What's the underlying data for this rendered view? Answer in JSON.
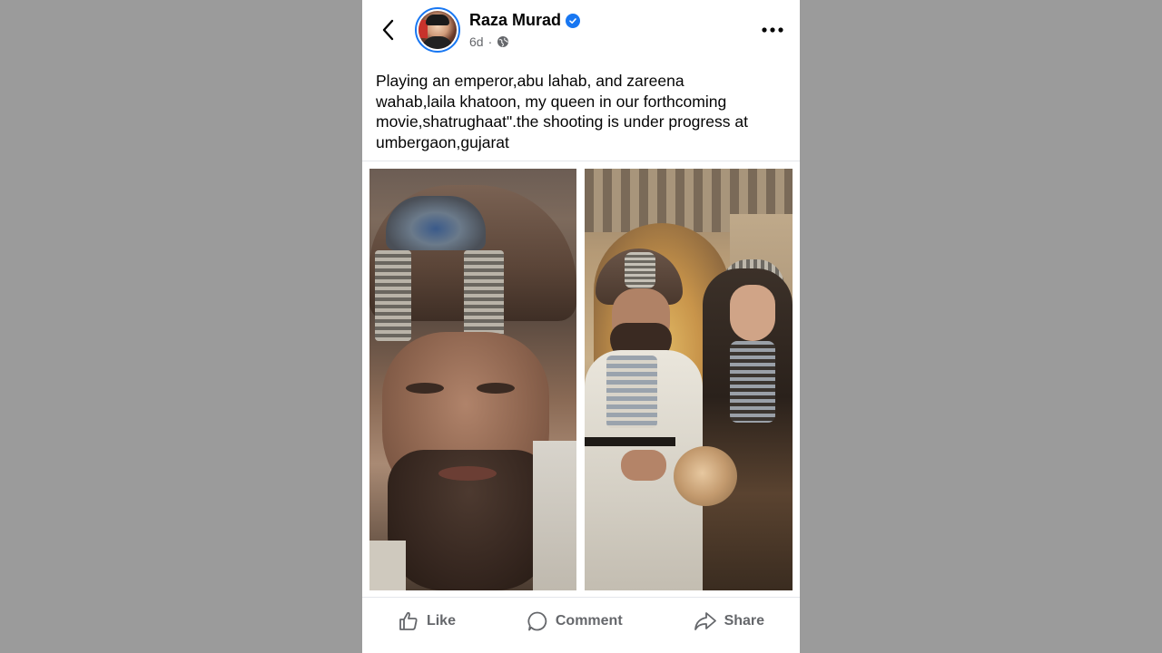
{
  "post": {
    "author": "Raza Murad",
    "time": "6d",
    "separator": "·",
    "audience_icon": "globe-icon",
    "verified_icon": "verified-badge-icon",
    "caption": "Playing an emperor,abu lahab, and zareena\nwahab,laila khatoon, my queen in our forthcoming\nmovie,shatrughaat\".the shooting is  under progress at\numbergaon,gujarat",
    "photos": [
      {
        "name": "photo-emperor-closeup"
      },
      {
        "name": "photo-emperor-and-queen"
      }
    ]
  },
  "actions": {
    "like": "Like",
    "comment": "Comment",
    "share": "Share"
  },
  "colors": {
    "background": "#9b9b9b",
    "card": "#ffffff",
    "accent": "#1877f2",
    "secondary_text": "#65676b"
  }
}
